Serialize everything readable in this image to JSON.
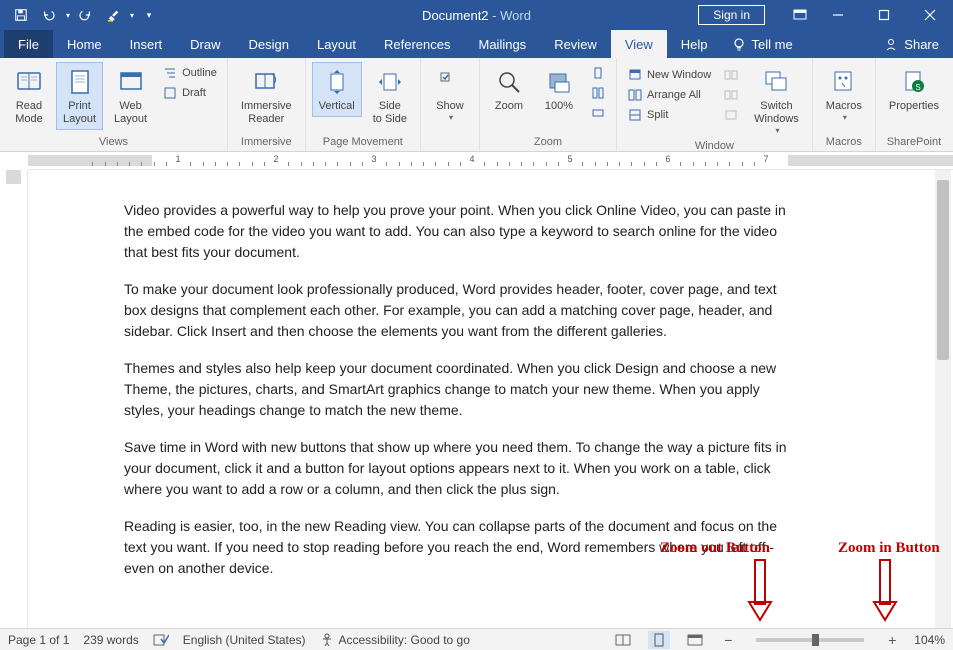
{
  "title": {
    "doc": "Document2",
    "app": "Word"
  },
  "qat": {
    "save": "save",
    "undo": "undo",
    "redo": "redo"
  },
  "signin": "Sign in",
  "tabs": {
    "file": "File",
    "home": "Home",
    "insert": "Insert",
    "draw": "Draw",
    "design": "Design",
    "layout": "Layout",
    "references": "References",
    "mailings": "Mailings",
    "review": "Review",
    "view": "View",
    "help": "Help",
    "tellme": "Tell me",
    "share": "Share"
  },
  "ribbon": {
    "views": {
      "label": "Views",
      "read_mode": "Read\nMode",
      "print_layout": "Print\nLayout",
      "web_layout": "Web\nLayout",
      "outline": "Outline",
      "draft": "Draft"
    },
    "immersive": {
      "label": "Immersive",
      "reader": "Immersive\nReader"
    },
    "page_movement": {
      "label": "Page Movement",
      "vertical": "Vertical",
      "side": "Side\nto Side"
    },
    "zoom": {
      "label": "Zoom",
      "zoom": "Zoom",
      "hundred": "100%",
      "one_page": "",
      "multi": "",
      "width": ""
    },
    "show": {
      "label": "",
      "show": "Show"
    },
    "window": {
      "label": "Window",
      "new": "New Window",
      "arrange": "Arrange All",
      "split": "Split",
      "switch": "Switch\nWindows"
    },
    "macros": {
      "label": "Macros",
      "macros": "Macros"
    },
    "sharepoint": {
      "label": "SharePoint",
      "props": "Properties"
    }
  },
  "doc": {
    "p1": "Video provides a powerful way to help you prove your point. When you click Online Video, you can paste in the embed code for the video you want to add. You can also type a keyword to search online for the video that best fits your document.",
    "p2": "To make your document look professionally produced, Word provides header, footer, cover page, and text box designs that complement each other. For example, you can add a matching cover page, header, and sidebar. Click Insert and then choose the elements you want from the different galleries.",
    "p3": "Themes and styles also help keep your document coordinated. When you click Design and choose a new Theme, the pictures, charts, and SmartArt graphics change to match your new theme. When you apply styles, your headings change to match the new theme.",
    "p4": "Save time in Word with new buttons that show up where you need them. To change the way a picture fits in your document, click it and a button for layout options appears next to it. When you work on a table, click where you want to add a row or a column, and then click the plus sign.",
    "p5": "Reading is easier, too, in the new Reading view. You can collapse parts of the document and focus on the text you want. If you need to stop reading before you reach the end, Word remembers where you left off - even on another device."
  },
  "annot": {
    "zoomout": "Zoom out Button",
    "zoomin": "Zoom in Button"
  },
  "status": {
    "page": "Page 1 of 1",
    "words": "239 words",
    "lang": "English (United States)",
    "a11y": "Accessibility: Good to go",
    "zoom": "104%"
  },
  "ruler_numbers": [
    "1",
    "2",
    "3",
    "4",
    "5",
    "6",
    "7"
  ]
}
